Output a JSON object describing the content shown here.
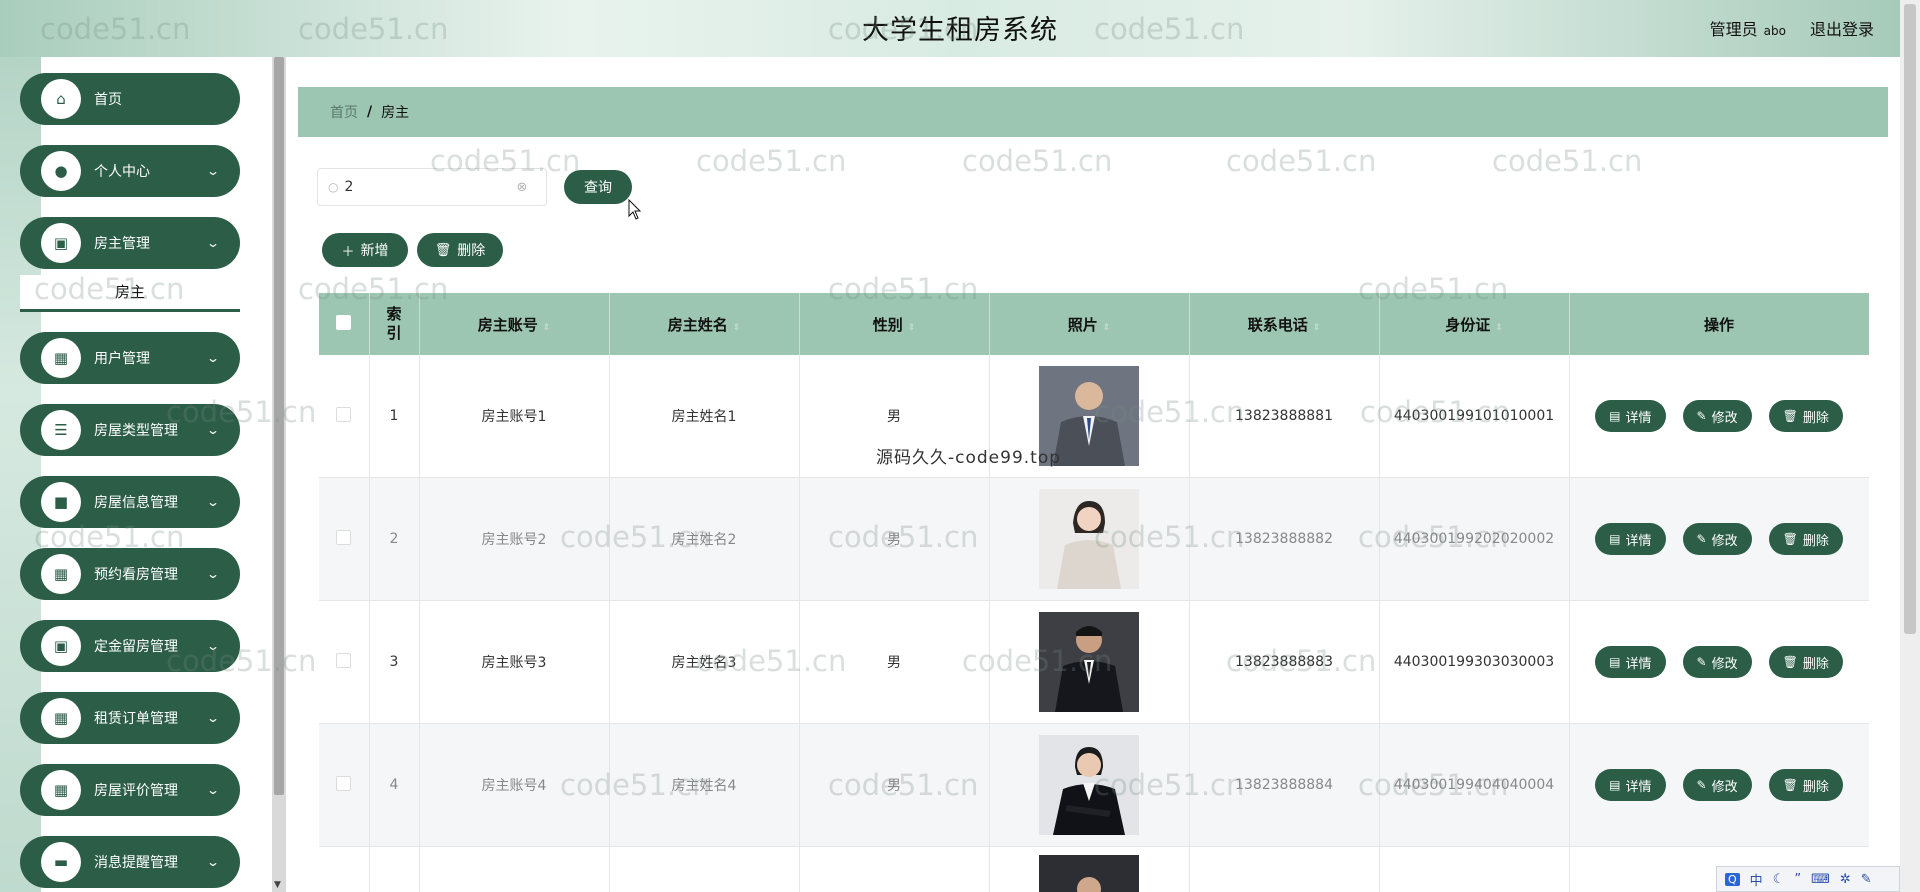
{
  "header": {
    "title": "大学生租房系统",
    "user_role": "管理员",
    "user_name": "abo",
    "logout": "退出登录"
  },
  "sidebar": {
    "items": [
      {
        "label": "首页",
        "icon": "home-icon",
        "expandable": false
      },
      {
        "label": "个人中心",
        "icon": "user-icon",
        "expandable": true
      },
      {
        "label": "房主管理",
        "icon": "clipboard-icon",
        "expandable": true
      },
      {
        "label": "用户管理",
        "icon": "grid-icon",
        "expandable": true
      },
      {
        "label": "房屋类型管理",
        "icon": "list-icon",
        "expandable": true
      },
      {
        "label": "房屋信息管理",
        "icon": "briefcase-icon",
        "expandable": true
      },
      {
        "label": "预约看房管理",
        "icon": "grid-icon",
        "expandable": true
      },
      {
        "label": "定金留房管理",
        "icon": "clipboard-icon",
        "expandable": true
      },
      {
        "label": "租赁订单管理",
        "icon": "grid-icon",
        "expandable": true
      },
      {
        "label": "房屋评价管理",
        "icon": "grid-icon",
        "expandable": true
      },
      {
        "label": "消息提醒管理",
        "icon": "monitor-icon",
        "expandable": true
      }
    ],
    "submenu_active": "房主"
  },
  "breadcrumb": {
    "home": "首页",
    "separator": "/",
    "current": "房主"
  },
  "search": {
    "value": "2",
    "query_label": "查询"
  },
  "actions": {
    "add_label": "新增",
    "delete_label": "删除"
  },
  "table": {
    "columns": [
      "索引",
      "房主账号",
      "房主姓名",
      "性别",
      "照片",
      "联系电话",
      "身份证",
      "操作"
    ],
    "rows": [
      {
        "index": "1",
        "account": "房主账号1",
        "name": "房主姓名1",
        "gender": "男",
        "phone": "13823888881",
        "id_card": "440300199101010001"
      },
      {
        "index": "2",
        "account": "房主账号2",
        "name": "房主姓名2",
        "gender": "男",
        "phone": "13823888882",
        "id_card": "440300199202020002"
      },
      {
        "index": "3",
        "account": "房主账号3",
        "name": "房主姓名3",
        "gender": "男",
        "phone": "13823888883",
        "id_card": "440300199303030003"
      },
      {
        "index": "4",
        "account": "房主账号4",
        "name": "房主姓名4",
        "gender": "男",
        "phone": "13823888884",
        "id_card": "440300199404040004"
      }
    ],
    "row_actions": {
      "detail": "详情",
      "edit": "修改",
      "delete": "删除"
    }
  },
  "watermark": "code51.cn",
  "source_mark": "源码久久-code99.top",
  "ime": {
    "lang": "中"
  },
  "colors": {
    "primary": "#2b5d47",
    "header_bg": "#9cc6b2",
    "row_alt": "#f5f6f8"
  }
}
